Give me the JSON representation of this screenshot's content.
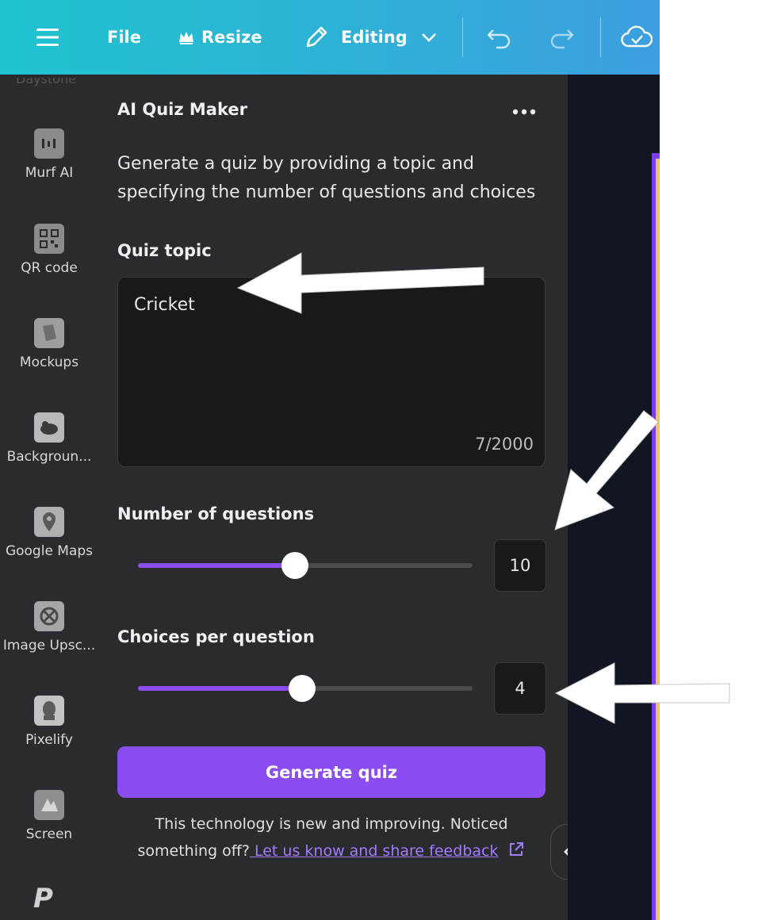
{
  "topbar": {
    "file_label": "File",
    "resize_label": "Resize",
    "editing_label": "Editing"
  },
  "sidebar": {
    "items": [
      {
        "label": "Murf AI",
        "icon": "murf-icon"
      },
      {
        "label": "QR code",
        "icon": "qr-code-icon"
      },
      {
        "label": "Mockups",
        "icon": "mockups-icon"
      },
      {
        "label": "Backgroun...",
        "icon": "backgrounds-icon"
      },
      {
        "label": "Google Maps",
        "icon": "map-pin-icon"
      },
      {
        "label": "Image Upsc...",
        "icon": "image-upscaler-icon"
      },
      {
        "label": "Pixelify",
        "icon": "pixelify-icon"
      },
      {
        "label": "Screen",
        "icon": "screen-icon"
      }
    ],
    "bottom_logo": "P"
  },
  "panel": {
    "title": "AI Quiz Maker",
    "description": "Generate a quiz by providing a topic and specifying the number of questions and choices",
    "quiz_topic_label": "Quiz topic",
    "quiz_topic_value": "Cricket",
    "char_count": "7/2000",
    "num_questions_label": "Number of questions",
    "num_questions_value": "10",
    "num_questions_fraction": 0.47,
    "choices_label": "Choices per question",
    "choices_value": "4",
    "choices_fraction": 0.49,
    "generate_label": "Generate quiz",
    "note_text": "This technology is new and improving. Noticed something off?",
    "feedback_link": " Let us know and share feedback"
  },
  "colors": {
    "accent": "#8b4df0",
    "panel_bg": "#2a2b2e",
    "topbar_start": "#1fc3cf",
    "topbar_end": "#3c9ee0"
  }
}
